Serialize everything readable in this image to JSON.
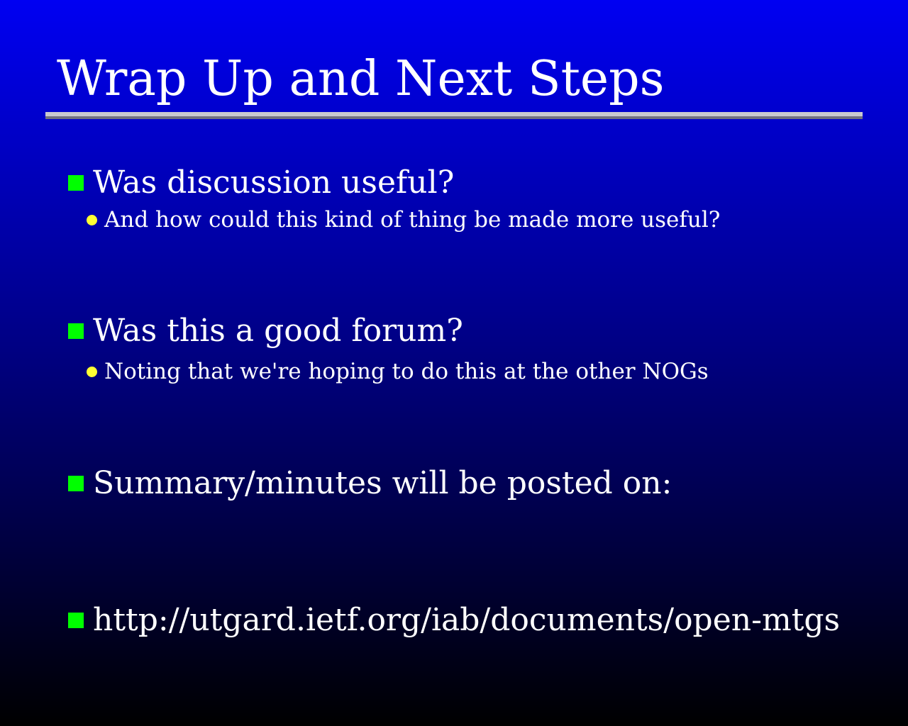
{
  "slide": {
    "title": "Wrap Up and Next Steps",
    "bullets": [
      {
        "text": "Was discussion useful?",
        "sub": "And how could this kind of thing be made more useful?"
      },
      {
        "text": "Was this a good forum?",
        "sub": "Noting that we're hoping to do this at the other NOGs"
      },
      {
        "text": "Summary/minutes will be posted on:"
      },
      {
        "text": "http://utgard.ietf.org/iab/documents/open-mtgs"
      }
    ]
  },
  "colors": {
    "background_top": "#0000f2",
    "background_bottom": "#000000",
    "square_bullet": "#00ff00",
    "dot_bullet": "#ffff33",
    "text": "#ffffff"
  }
}
